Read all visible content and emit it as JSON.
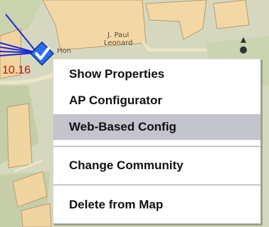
{
  "map": {
    "building_label_line1": "J. Paul",
    "building_label_line2": "Leonard",
    "building_label_partial": "Hon",
    "ap_ip_partial": "10.16"
  },
  "context_menu": {
    "items": [
      {
        "label": "Show Properties"
      },
      {
        "label": "AP Configurator"
      },
      {
        "label": "Web-Based Config",
        "highlighted": true
      },
      {
        "label": "Change Community"
      },
      {
        "label": "Delete from Map"
      }
    ]
  },
  "colors": {
    "highlight": "#c3c4cc",
    "ip_text": "#e00000",
    "link_line": "#1a2bd6"
  }
}
